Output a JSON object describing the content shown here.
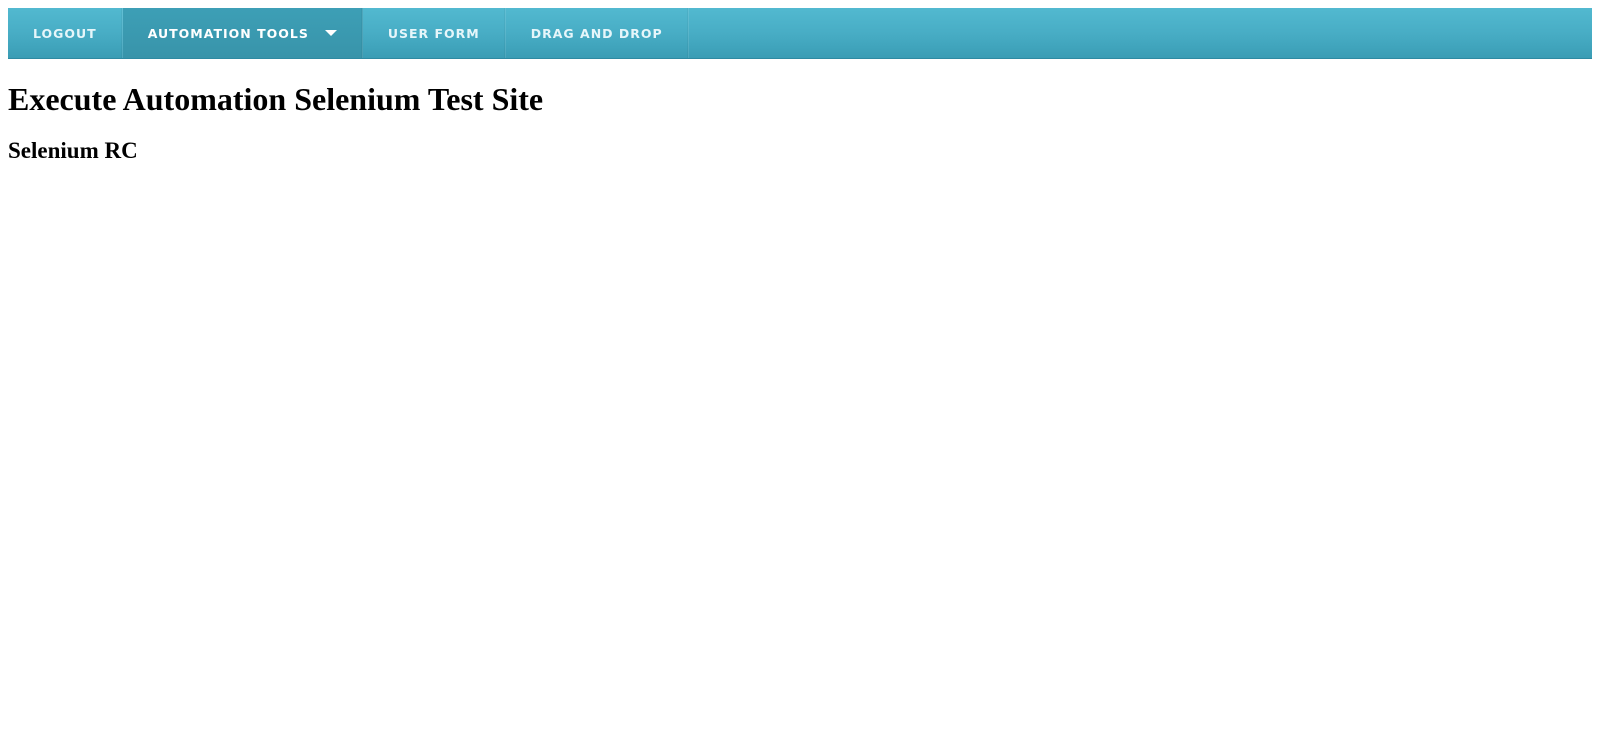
{
  "nav": {
    "items": [
      {
        "label": "LOGOUT"
      },
      {
        "label": "AUTOMATION TOOLS",
        "active": true,
        "has_dropdown": true
      },
      {
        "label": "USER FORM"
      },
      {
        "label": "DRAG AND DROP"
      }
    ],
    "colors": {
      "bar": "#48adc5",
      "active": "#3894aa",
      "text": "#e6f6fa"
    },
    "dropdown_icon": "caret-down-icon"
  },
  "main": {
    "title": "Execute Automation Selenium Test Site",
    "subtitle": "Selenium RC"
  }
}
